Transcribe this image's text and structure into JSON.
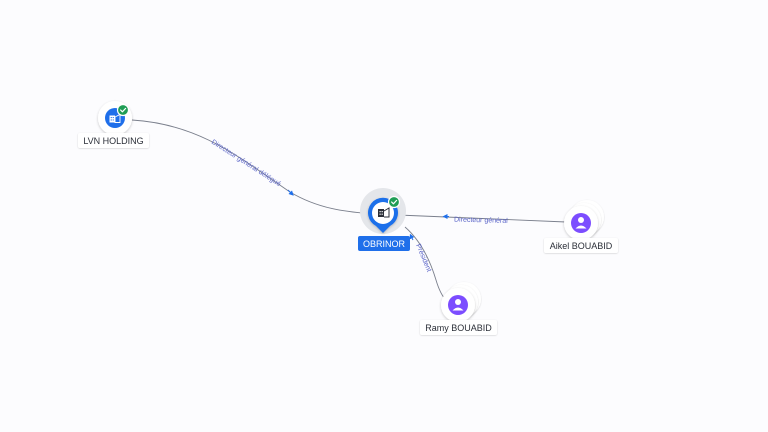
{
  "colors": {
    "accent": "#1f6fea",
    "edge": "#7a7f8c",
    "edge_label": "#5a64c8",
    "person": "#7c4dff",
    "verified": "#1f9d55",
    "label_text": "#2b2f38",
    "label_bg": "#ffffff"
  },
  "nodes": {
    "center": {
      "label": "OBRINOR",
      "icon": "building-icon",
      "verified": true
    },
    "company": {
      "label": "LVN HOLDING",
      "icon": "building-icon",
      "verified": true
    },
    "person_1": {
      "label": "Aikel BOUABID",
      "icon": "person-icon"
    },
    "person_2": {
      "label": "Ramy BOUABID",
      "icon": "person-icon"
    }
  },
  "edges": {
    "company_to_center": {
      "label": "Directeur général délégué"
    },
    "person_1_to_center": {
      "label": "Directeur général"
    },
    "person_2_to_center": {
      "label": "Président"
    }
  }
}
